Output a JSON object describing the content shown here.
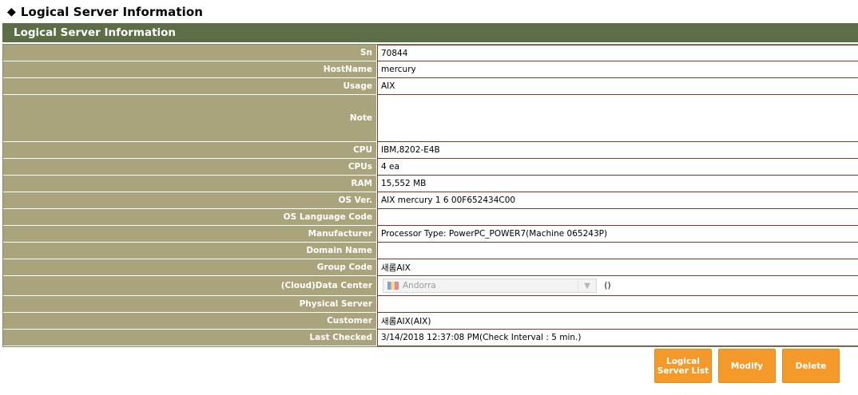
{
  "page_title": "Logical Server Information",
  "section_header": "Logical Server Information",
  "fields": {
    "sn": {
      "label": "Sn",
      "value": "70844"
    },
    "hostname": {
      "label": "HostName",
      "value": "mercury"
    },
    "usage": {
      "label": "Usage",
      "value": "AIX"
    },
    "note": {
      "label": "Note",
      "value": ""
    },
    "cpu": {
      "label": "CPU",
      "value": "IBM,8202-E4B"
    },
    "cpus": {
      "label": "CPUs",
      "value": "4 ea"
    },
    "ram": {
      "label": "RAM",
      "value": "15,552 MB"
    },
    "os_ver": {
      "label": "OS Ver.",
      "value": "AIX mercury 1 6 00F652434C00"
    },
    "os_language_code": {
      "label": "OS Language Code",
      "value": ""
    },
    "manufacturer": {
      "label": "Manufacturer",
      "value": "Processor Type: PowerPC_POWER7(Machine 065243P)"
    },
    "domain_name": {
      "label": "Domain Name",
      "value": ""
    },
    "group_code": {
      "label": "Group Code",
      "value": "새롬AIX"
    },
    "data_center": {
      "label": "(Cloud)Data Center",
      "selected": "Andorra",
      "suffix": "()"
    },
    "physical_server": {
      "label": "Physical Server",
      "value": ""
    },
    "customer": {
      "label": "Customer",
      "value": "새롬AIX(AIX)"
    },
    "last_checked": {
      "label": "Last Checked",
      "value": "3/14/2018 12:37:08 PM(Check Interval : 5 min.)"
    }
  },
  "buttons": {
    "list_line1": "Logical",
    "list_line2": "Server List",
    "modify": "Modify",
    "delete": "Delete"
  },
  "colors": {
    "header_bg": "#5b6e45",
    "label_bg": "#aaa47d",
    "button_bg": "#f39a2b"
  }
}
